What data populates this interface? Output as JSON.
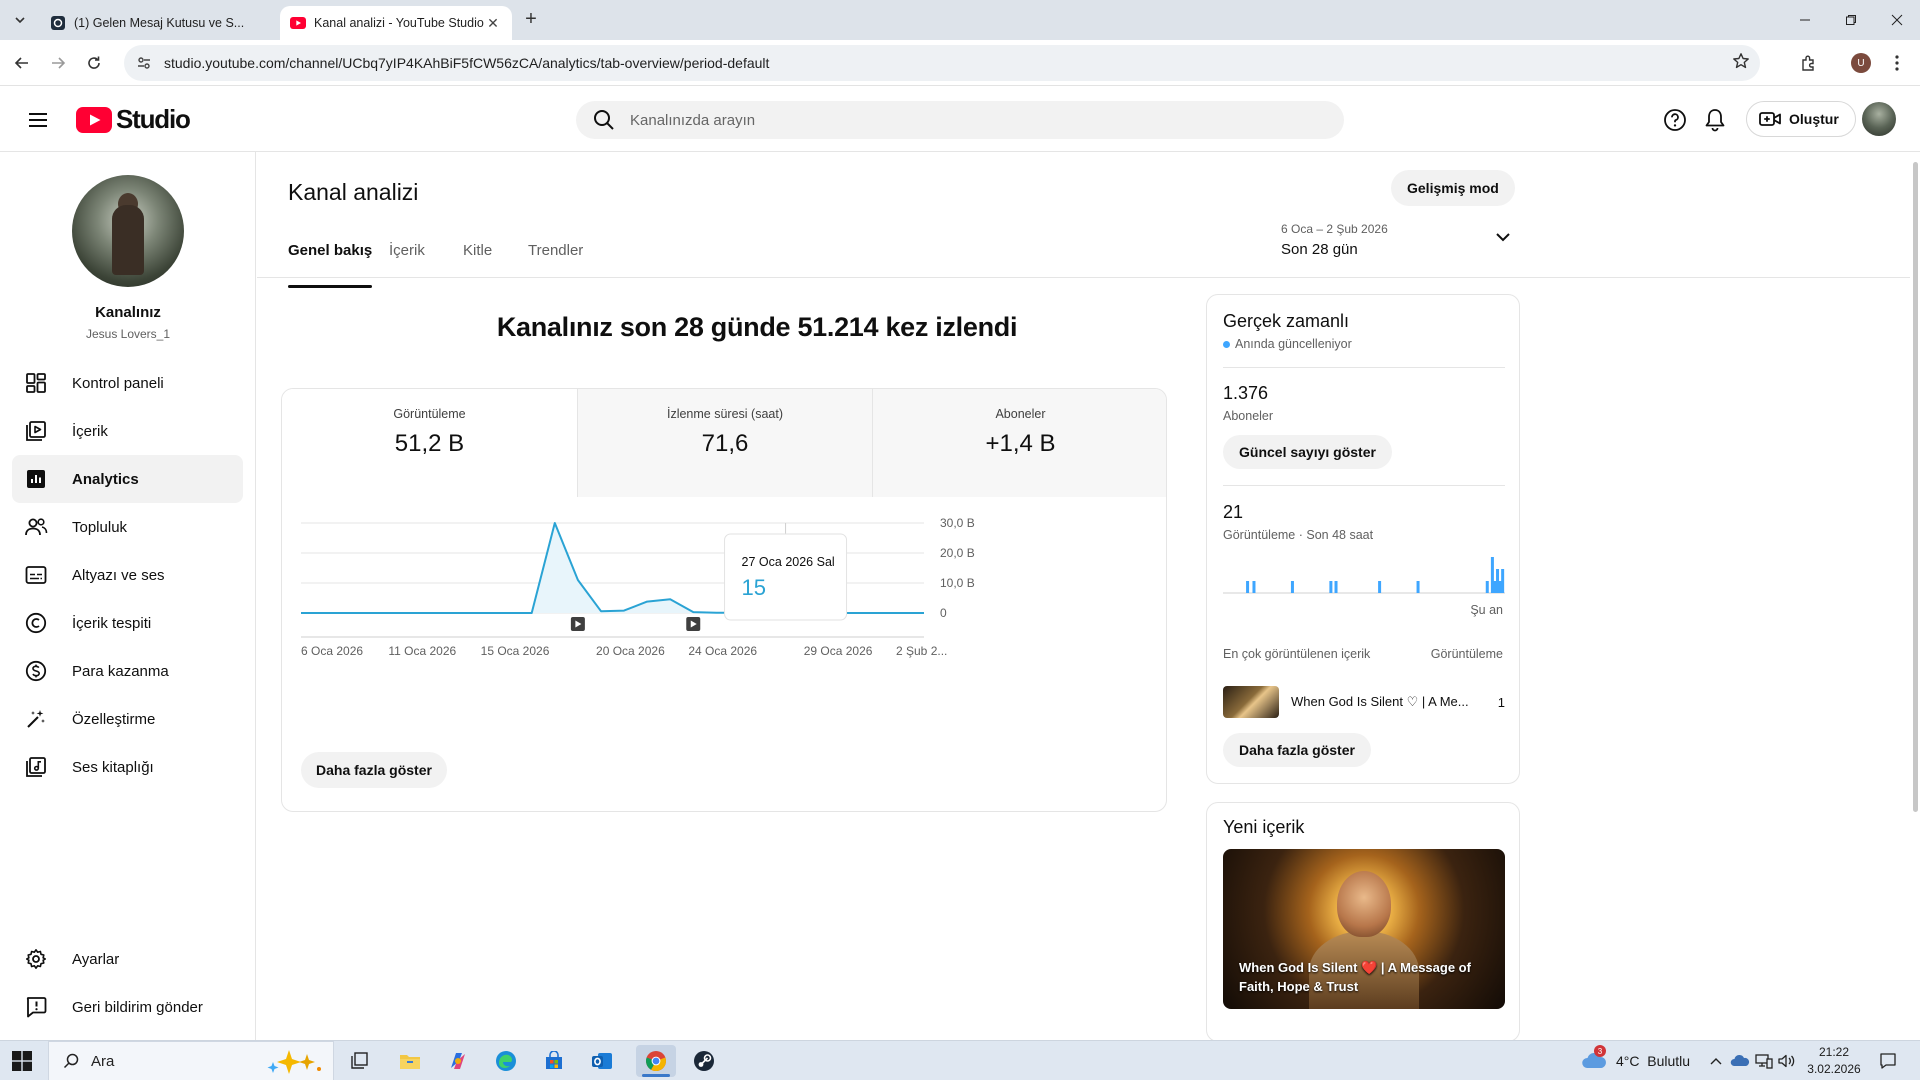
{
  "browser": {
    "tabs": [
      {
        "title": "(1) Gelen Mesaj Kutusu ve S..."
      },
      {
        "title": "Kanal analizi - YouTube Studio"
      }
    ],
    "url": "studio.youtube.com/channel/UCbq7yIP4KAhBiF5fCW56zCA/analytics/tab-overview/period-default",
    "profile_initial": "U"
  },
  "header": {
    "logo_text": "Studio",
    "search_placeholder": "Kanalınızda arayın",
    "create_label": "Oluştur"
  },
  "sidebar": {
    "channel_label": "Kanalınız",
    "channel_handle": "Jesus Lovers_1",
    "items": [
      {
        "label": "Kontrol paneli",
        "icon": "dashboard-icon"
      },
      {
        "label": "İçerik",
        "icon": "content-icon"
      },
      {
        "label": "Analytics",
        "icon": "analytics-icon",
        "active": true
      },
      {
        "label": "Topluluk",
        "icon": "community-icon"
      },
      {
        "label": "Altyazı ve ses",
        "icon": "subtitles-icon"
      },
      {
        "label": "İçerik tespiti",
        "icon": "copyright-icon"
      },
      {
        "label": "Para kazanma",
        "icon": "monetization-icon"
      },
      {
        "label": "Özelleştirme",
        "icon": "customization-icon"
      },
      {
        "label": "Ses kitaplığı",
        "icon": "audio-library-icon"
      }
    ],
    "bottom_items": [
      {
        "label": "Ayarlar",
        "icon": "settings-icon"
      },
      {
        "label": "Geri bildirim gönder",
        "icon": "feedback-icon"
      }
    ]
  },
  "main": {
    "title": "Kanal analizi",
    "advanced_mode_label": "Gelişmiş mod",
    "tabs": [
      {
        "label": "Genel bakış",
        "active": true
      },
      {
        "label": "İçerik"
      },
      {
        "label": "Kitle"
      },
      {
        "label": "Trendler"
      }
    ],
    "date_range": {
      "dates": "6 Oca – 2 Şub 2026",
      "label": "Son 28 gün"
    },
    "headline": "Kanalınız son 28 günde 51.214 kez izlendi",
    "metrics": [
      {
        "label": "Görüntüleme",
        "value": "51,2 B"
      },
      {
        "label": "İzlenme süresi (saat)",
        "value": "71,6"
      },
      {
        "label": "Aboneler",
        "value": "+1,4 B"
      }
    ],
    "show_more_label": "Daha fazla göster"
  },
  "chart_data": {
    "type": "area",
    "x_tick_labels": [
      "6 Oca 2026",
      "11 Oca 2026",
      "15 Oca 2026",
      "20 Oca 2026",
      "24 Oca 2026",
      "29 Oca 2026",
      "2 Şub 2..."
    ],
    "y_tick_labels": [
      "30,0 B",
      "20,0 B",
      "10,0 B",
      "0"
    ],
    "ylim": [
      0,
      30000
    ],
    "x": [
      "2026-01-06",
      "2026-01-07",
      "2026-01-08",
      "2026-01-09",
      "2026-01-10",
      "2026-01-11",
      "2026-01-12",
      "2026-01-13",
      "2026-01-14",
      "2026-01-15",
      "2026-01-16",
      "2026-01-17",
      "2026-01-18",
      "2026-01-19",
      "2026-01-20",
      "2026-01-21",
      "2026-01-22",
      "2026-01-23",
      "2026-01-24",
      "2026-01-25",
      "2026-01-26",
      "2026-01-27",
      "2026-01-28",
      "2026-01-29",
      "2026-01-30",
      "2026-01-31",
      "2026-02-01",
      "2026-02-02"
    ],
    "values": [
      0,
      0,
      0,
      0,
      0,
      0,
      0,
      0,
      0,
      0,
      0,
      30000,
      11000,
      600,
      800,
      3800,
      4600,
      300,
      100,
      50,
      30,
      15,
      10,
      10,
      10,
      10,
      10,
      10
    ],
    "video_markers": [
      "2026-01-18",
      "2026-01-23"
    ],
    "hover": {
      "date_label": "27 Oca 2026 Sal",
      "value_label": "15",
      "x": "2026-01-27"
    },
    "colors": {
      "line": "#2aa3d4",
      "fill": "#e8f5fb"
    }
  },
  "realtime": {
    "title": "Gerçek zamanlı",
    "live_label": "Anında güncelleniyor",
    "subscribers_value": "1.376",
    "subscribers_label": "Aboneler",
    "show_count_label": "Güncel sayıyı göster",
    "views_value": "21",
    "views_label": "Görüntüleme · Son 48 saat",
    "now_label": "Şu an",
    "top_content_label": "En çok görüntülenen içerik",
    "views_col_label": "Görüntüleme",
    "top_video_title": "When God Is Silent ♡ | A Me...",
    "top_video_views": "1",
    "show_more_label": "Daha fazla göster",
    "bars_48h": [
      0,
      0,
      0,
      0,
      0,
      0,
      0,
      0,
      0,
      0,
      0,
      0,
      0,
      0,
      0,
      0,
      0,
      0,
      1,
      0,
      0,
      0,
      0,
      1,
      0,
      0,
      0,
      0,
      0,
      0,
      0,
      0,
      0,
      0,
      0,
      0,
      0,
      0,
      0,
      0,
      0,
      0,
      0,
      0,
      0,
      0,
      0,
      0,
      0,
      0,
      0,
      0,
      0,
      1,
      0,
      0,
      0,
      0,
      0,
      0,
      0,
      0,
      0,
      0,
      0,
      0,
      0,
      0,
      0,
      0,
      0,
      0,
      0,
      0,
      0,
      0,
      0,
      0,
      0,
      0,
      0,
      0,
      0,
      1,
      0,
      0,
      0,
      1,
      0,
      0,
      0,
      0,
      0,
      0,
      0,
      0,
      0,
      0,
      0,
      0,
      0,
      0,
      0,
      0,
      0,
      0,
      0,
      0,
      0,
      0,
      0,
      0,
      0,
      0,
      0,
      0,
      0,
      0,
      0,
      0,
      0,
      1,
      0,
      0,
      0,
      0,
      0,
      0,
      0,
      0,
      0,
      0,
      0,
      0,
      0,
      0,
      0,
      0,
      0,
      0,
      0,
      0,
      0,
      0,
      0,
      0,
      0,
      0,
      0,
      0,
      0,
      1,
      0,
      0,
      0,
      0,
      0,
      0,
      0,
      0,
      0,
      0,
      0,
      0,
      0,
      0,
      0,
      0,
      0,
      0,
      0,
      0,
      0,
      0,
      0,
      0,
      0,
      0,
      0,
      0,
      0,
      0,
      0,
      0,
      0,
      0,
      0,
      0,
      0,
      0,
      0,
      0,
      0,
      0,
      0,
      0,
      0,
      0,
      0,
      0,
      0,
      0,
      0,
      0,
      0,
      1,
      0,
      0,
      0,
      3,
      0,
      1,
      0,
      2,
      0,
      1,
      0,
      2,
      0,
      0
    ],
    "bar_color": "#3ea6ff"
  },
  "new_content": {
    "title": "Yeni içerik",
    "thumb_title": "When God Is Silent ❤️ | A Message of Faith, Hope & Trust"
  },
  "taskbar": {
    "search_label": "Ara",
    "weather": "4°C  Bulutlu",
    "weather_badge": "3",
    "time": "21:22",
    "date": "3.02.2026"
  }
}
